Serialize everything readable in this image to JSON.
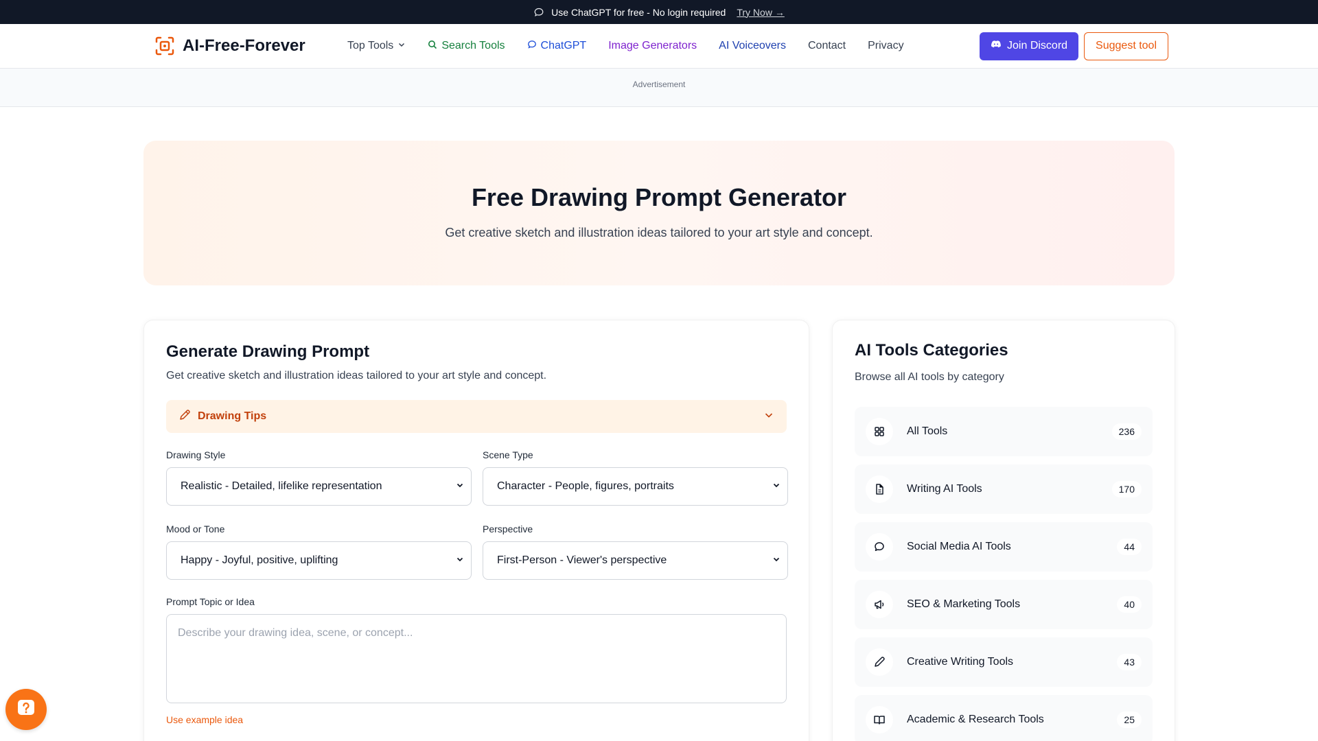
{
  "announcement": {
    "text": "Use ChatGPT for free - No login required",
    "link": "Try Now →"
  },
  "brand": {
    "name": "AI-Free-Forever"
  },
  "nav": {
    "top_tools": "Top Tools",
    "search_tools": "Search Tools",
    "chatgpt": "ChatGPT",
    "image_generators": "Image Generators",
    "ai_voiceovers": "AI Voiceovers",
    "contact": "Contact",
    "privacy": "Privacy",
    "join_discord": "Join Discord",
    "suggest_tool": "Suggest tool"
  },
  "ad": {
    "label": "Advertisement"
  },
  "hero": {
    "title": "Free Drawing Prompt Generator",
    "subtitle": "Get creative sketch and illustration ideas tailored to your art style and concept."
  },
  "form": {
    "title": "Generate Drawing Prompt",
    "subtitle": "Get creative sketch and illustration ideas tailored to your art style and concept.",
    "tips_label": "Drawing Tips",
    "fields": {
      "drawing_style": {
        "label": "Drawing Style",
        "value": "Realistic - Detailed, lifelike representation"
      },
      "scene_type": {
        "label": "Scene Type",
        "value": "Character - People, figures, portraits"
      },
      "mood": {
        "label": "Mood or Tone",
        "value": "Happy - Joyful, positive, uplifting"
      },
      "perspective": {
        "label": "Perspective",
        "value": "First-Person - Viewer's perspective"
      }
    },
    "topic": {
      "label": "Prompt Topic or Idea",
      "placeholder": "Describe your drawing idea, scene, or concept..."
    },
    "example_link": "Use example idea"
  },
  "categories": {
    "title": "AI Tools Categories",
    "subtitle": "Browse all AI tools by category",
    "items": [
      {
        "name": "All Tools",
        "count": "236",
        "icon": "grid-icon"
      },
      {
        "name": "Writing AI Tools",
        "count": "170",
        "icon": "document-icon"
      },
      {
        "name": "Social Media AI Tools",
        "count": "44",
        "icon": "chat-bubble-icon"
      },
      {
        "name": "SEO & Marketing Tools",
        "count": "40",
        "icon": "megaphone-icon"
      },
      {
        "name": "Creative Writing Tools",
        "count": "43",
        "icon": "pencil-icon"
      },
      {
        "name": "Academic & Research Tools",
        "count": "25",
        "icon": "book-icon"
      }
    ]
  },
  "colors": {
    "accent": "#ea580c",
    "discord": "#4f46e5",
    "announcement_bg": "#111827"
  }
}
